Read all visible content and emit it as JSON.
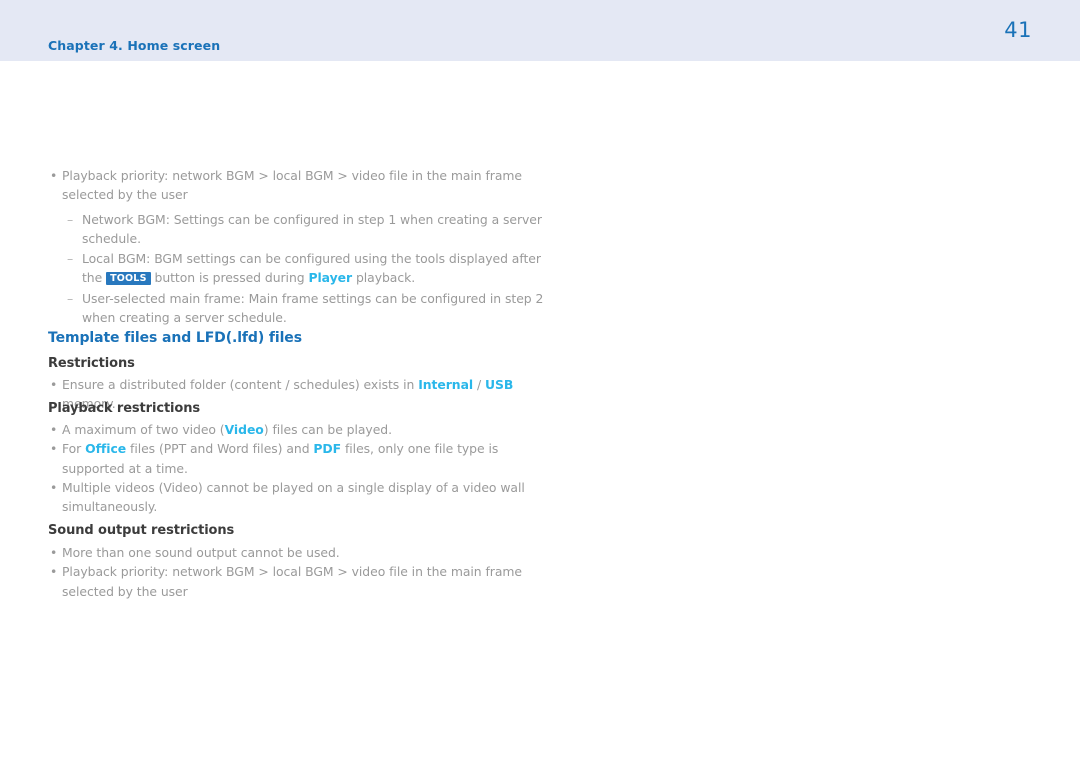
{
  "header": {
    "chapter": "Chapter 4. Home screen",
    "page_number": "41",
    "band_color": "#e4e8f4",
    "accent_color": "#1a72b8"
  },
  "colors": {
    "heading_blue": "#1a72b8",
    "inline_highlight": "#2ab7ea",
    "badge_background": "#2878be",
    "badge_text": "#ffffff",
    "body_text": "#9a9a9a",
    "subheading_text": "#3c3c3c"
  },
  "content": {
    "intro_bullets": [
      {
        "text_before": "Playback priority: network BGM > local BGM > video file in the main frame selected by the user",
        "subitems": [
          {
            "text": "Network BGM: Settings can be configured in step 1 when creating a server schedule."
          },
          {
            "text_part1": "Local BGM: BGM settings can be configured using the tools displayed after the ",
            "badge": "TOOLS",
            "text_part2": " button is pressed during ",
            "highlight": "Player",
            "text_part3": " playback."
          },
          {
            "text": "User-selected main frame: Main frame settings can be configured in step 2 when creating a server schedule."
          }
        ]
      }
    ],
    "section": {
      "title": "Template files and LFD(.lfd) files",
      "groups": [
        {
          "heading": "Restrictions",
          "items": [
            {
              "text_part1": "Ensure a distributed folder (content / schedules) exists in ",
              "highlight1": "Internal",
              "text_part2": " / ",
              "highlight2": "USB",
              "text_part3": " memory."
            }
          ]
        },
        {
          "heading": "Playback restrictions",
          "items": [
            {
              "text_part1": "A maximum of two video (",
              "highlight1": "Video",
              "text_part2": ") files can be played."
            },
            {
              "text_part1": "For ",
              "highlight1": "Office",
              "text_part2": " files (PPT and Word files) and ",
              "highlight2": "PDF",
              "text_part3": " files, only one file type is supported at a time."
            },
            {
              "text": "Multiple videos (Video) cannot be played on a single display of a video wall simultaneously."
            }
          ]
        },
        {
          "heading": "Sound output restrictions",
          "items": [
            {
              "text": "More than one sound output cannot be used."
            },
            {
              "text": "Playback priority: network BGM > local BGM > video file in the main frame selected by the user"
            }
          ]
        }
      ]
    }
  },
  "markers": {
    "bullet": "•",
    "dash": "–"
  }
}
